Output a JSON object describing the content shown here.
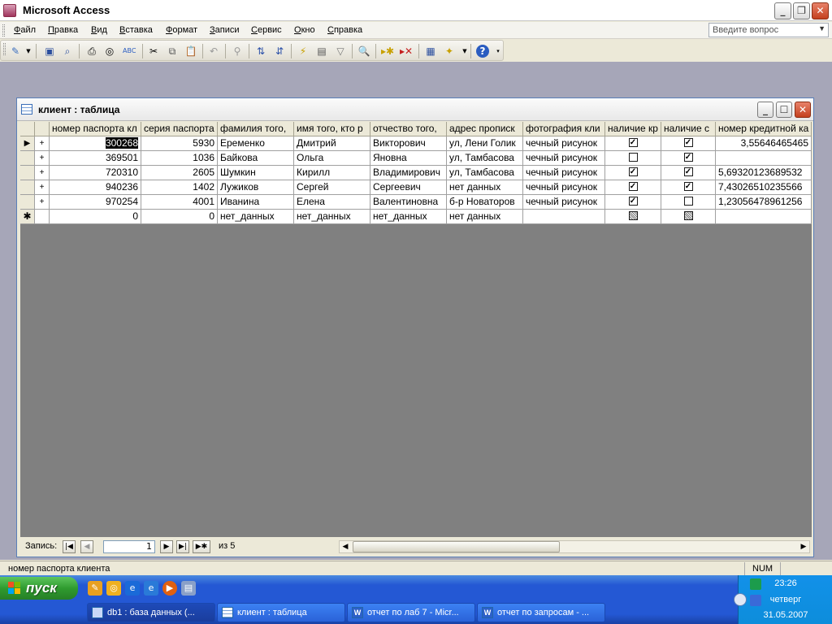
{
  "app": {
    "title": "Microsoft Access"
  },
  "menu": {
    "items": [
      "Файл",
      "Правка",
      "Вид",
      "Вставка",
      "Формат",
      "Записи",
      "Сервис",
      "Окно",
      "Справка"
    ],
    "help_placeholder": "Введите вопрос"
  },
  "toolbar": {
    "icons": [
      "view-design-icon",
      "save-icon",
      "search-files-icon",
      "print-icon",
      "print-preview-icon",
      "spelling-icon",
      "cut-icon",
      "copy-icon",
      "paste-icon",
      "undo-icon",
      "hyperlink-icon",
      "sort-asc-icon",
      "sort-desc-icon",
      "filter-by-selection-icon",
      "filter-by-form-icon",
      "apply-filter-icon",
      "find-icon",
      "new-record-icon",
      "delete-record-icon",
      "database-window-icon",
      "new-object-icon",
      "help-icon"
    ]
  },
  "table_window": {
    "title": "клиент : таблица",
    "columns": [
      "номер паспорта кл",
      "серия паспорта",
      "фамилия того,",
      "имя того, кто р",
      "отчество того,",
      "адрес прописк",
      "фотография кли",
      "наличие кр",
      "наличие с",
      "номер кредитной ка"
    ],
    "rows": [
      {
        "passport_num": "300268",
        "series": "5930",
        "surname": "Еременко",
        "name": "Дмитрий",
        "patronymic": "Викторович",
        "address": "ул, Лени Голик",
        "photo": "чечный рисунок",
        "has_credit": true,
        "has_s": true,
        "card_num": "3,55646465465"
      },
      {
        "passport_num": "369501",
        "series": "1036",
        "surname": "Байкова",
        "name": "Ольга",
        "patronymic": "Яновна",
        "address": "ул, Тамбасова",
        "photo": "чечный рисунок",
        "has_credit": false,
        "has_s": true,
        "card_num": ""
      },
      {
        "passport_num": "720310",
        "series": "2605",
        "surname": "Шумкин",
        "name": "Кирилл",
        "patronymic": "Владимирович",
        "address": "ул, Тамбасова",
        "photo": "чечный рисунок",
        "has_credit": true,
        "has_s": true,
        "card_num": "5,69320123689532"
      },
      {
        "passport_num": "940236",
        "series": "1402",
        "surname": "Лужиков",
        "name": "Сергей",
        "patronymic": "Сергеевич",
        "address": "нет данных",
        "photo": "чечный рисунок",
        "has_credit": true,
        "has_s": true,
        "card_num": "7,43026510235566"
      },
      {
        "passport_num": "970254",
        "series": "4001",
        "surname": "Иванина",
        "name": "Елена",
        "patronymic": "Валентиновна",
        "address": "б-р Новаторов",
        "photo": "чечный рисунок",
        "has_credit": true,
        "has_s": false,
        "card_num": "1,23056478961256"
      }
    ],
    "new_row": {
      "passport_num": "0",
      "series": "0",
      "surname": "нет_данных",
      "name": "нет_данных",
      "patronymic": "нет_данных",
      "address": "нет данных"
    },
    "nav": {
      "label": "Запись:",
      "current": "1",
      "total_label": "из  5"
    }
  },
  "status": {
    "text": "номер паспорта клиента",
    "num": "NUM"
  },
  "taskbar": {
    "start_label": "пуск",
    "tasks": [
      "db1 : база данных (...",
      "клиент : таблица",
      "отчет по лаб 7 - Micr...",
      "отчет по запросам - ..."
    ],
    "clock": {
      "time": "23:26",
      "day": "четверг",
      "date": "31.05.2007"
    }
  },
  "colors": {
    "workspace": "#a6a6b8",
    "taskbar": "#2458d4",
    "start": "#2f9b2f",
    "datasheet_bg": "#808080"
  }
}
